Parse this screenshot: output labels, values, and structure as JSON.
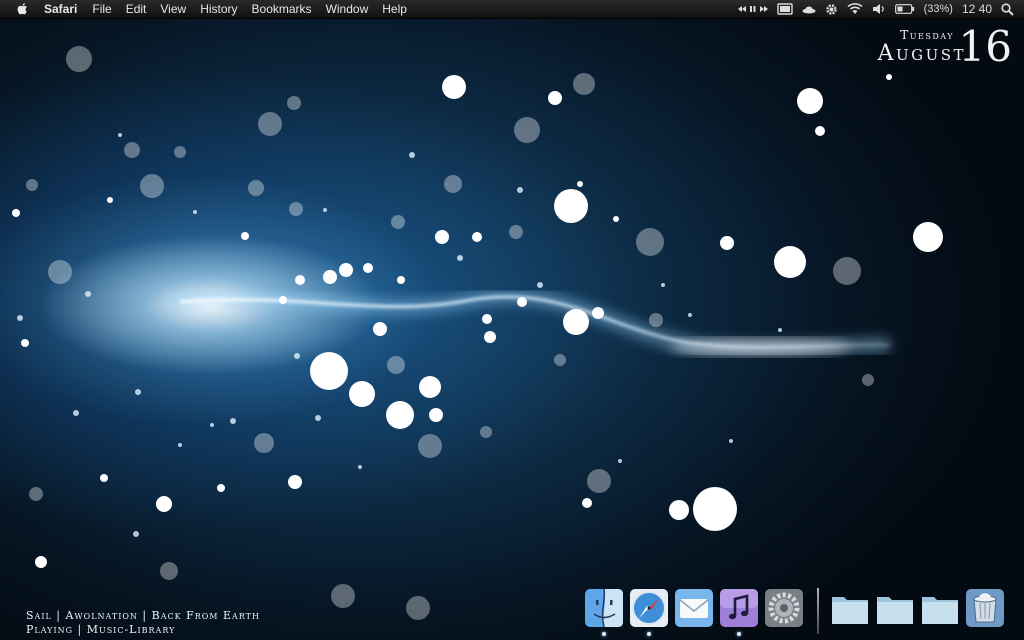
{
  "menubar": {
    "apple": "apple-logo",
    "items": [
      "Safari",
      "File",
      "Edit",
      "View",
      "History",
      "Bookmarks",
      "Window",
      "Help"
    ],
    "status": {
      "battery_percent": "(33%)",
      "clock": "12 40"
    }
  },
  "clock_widget": {
    "weekday": "Tuesday",
    "month": "August",
    "day": "16"
  },
  "now_playing": {
    "line1": "Sail | Awolnation | Back From Earth",
    "line2": "Playing | Music-Library"
  },
  "dock": {
    "apps": [
      {
        "icon": "finder-icon",
        "running": true
      },
      {
        "icon": "safari-icon",
        "running": true
      },
      {
        "icon": "mail-icon",
        "running": false
      },
      {
        "icon": "itunes-icon",
        "running": true
      },
      {
        "icon": "system-preferences-icon",
        "running": false
      }
    ],
    "stacks": [
      {
        "icon": "folder-icon"
      },
      {
        "icon": "folder-icon"
      },
      {
        "icon": "folder-icon"
      },
      {
        "icon": "trash-icon"
      }
    ]
  }
}
